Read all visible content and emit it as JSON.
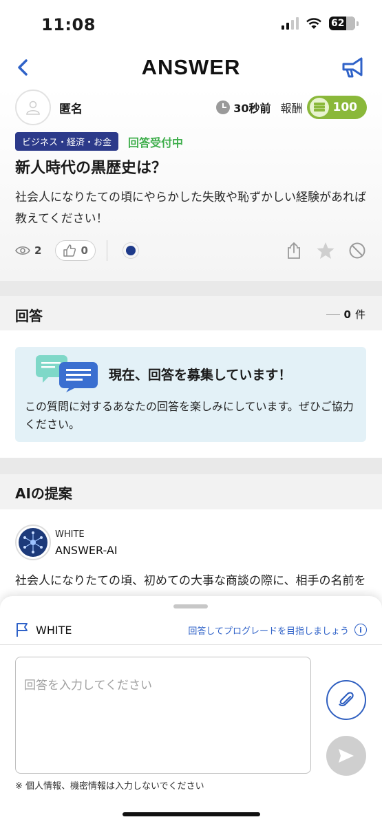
{
  "status_bar": {
    "time": "11:08",
    "battery": "62"
  },
  "header": {
    "logo": "ANSWER"
  },
  "question": {
    "username": "匿名",
    "time_ago": "30秒前",
    "reward_label": "報酬",
    "reward_value": "100",
    "category": "ビジネス・経済・お金",
    "status": "回答受付中",
    "title": "新人時代の黒歴史は？",
    "body": "社会人になりたての頃にやらかした失敗や恥ずかしい経験があれば教えてください！",
    "views": "2",
    "likes": "0"
  },
  "answers": {
    "section_title": "回答",
    "count": "0",
    "count_unit": "件",
    "recruit_title": "現在、回答を募集しています！",
    "recruit_text": "この質問に対するあなたの回答を楽しみにしています。ぜひご協力ください。"
  },
  "ai": {
    "section_title": "AIの提案",
    "grade": "WHITE",
    "name": "ANSWER-AI",
    "text": "社会人になりたての頃、初めての大事な商談の際に、相手の名前を間違えて呼んでしまったことがあります。そ"
  },
  "sheet": {
    "grade": "WHITE",
    "upgrade_text": "回答してプログレードを目指しましょう",
    "input_placeholder": "回答を入力してください",
    "notice": "※ 個人情報、機密情報は入力しないでください"
  },
  "colors": {
    "accent_blue": "#2f62c8",
    "category_bg": "#2c3a8a",
    "status_green": "#3fae4c",
    "reward_green": "#8ab83a",
    "recruit_bg": "#e3f1f7"
  },
  "icons": [
    "back-chevron-icon",
    "megaphone-icon",
    "clock-icon",
    "coin-icon",
    "eye-icon",
    "thumbs-up-icon",
    "share-icon",
    "star-icon",
    "block-icon",
    "chat-bubbles-icon",
    "network-icon",
    "flag-icon",
    "info-icon",
    "paperclip-icon",
    "send-icon"
  ]
}
